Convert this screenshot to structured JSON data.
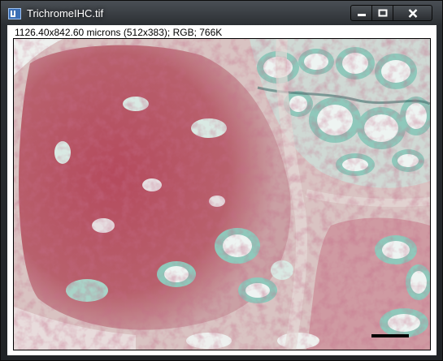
{
  "window": {
    "title": "TrichromeIHC.tif",
    "app_icon": "imagej-icon",
    "controls": {
      "minimize": "minimize-icon",
      "maximize": "maximize-icon",
      "close": "close-icon"
    }
  },
  "image_info": {
    "text": "1126.40x842.60 microns (512x383); RGB; 766K"
  },
  "colors": {
    "frame_dark": "#202326",
    "tissue_red": "#b0485a",
    "stroma_pink": "#d7b7b7",
    "cyst_green": "#8fc8bb",
    "lumen_white": "#eef4f2",
    "scale_bar": "#000000"
  }
}
